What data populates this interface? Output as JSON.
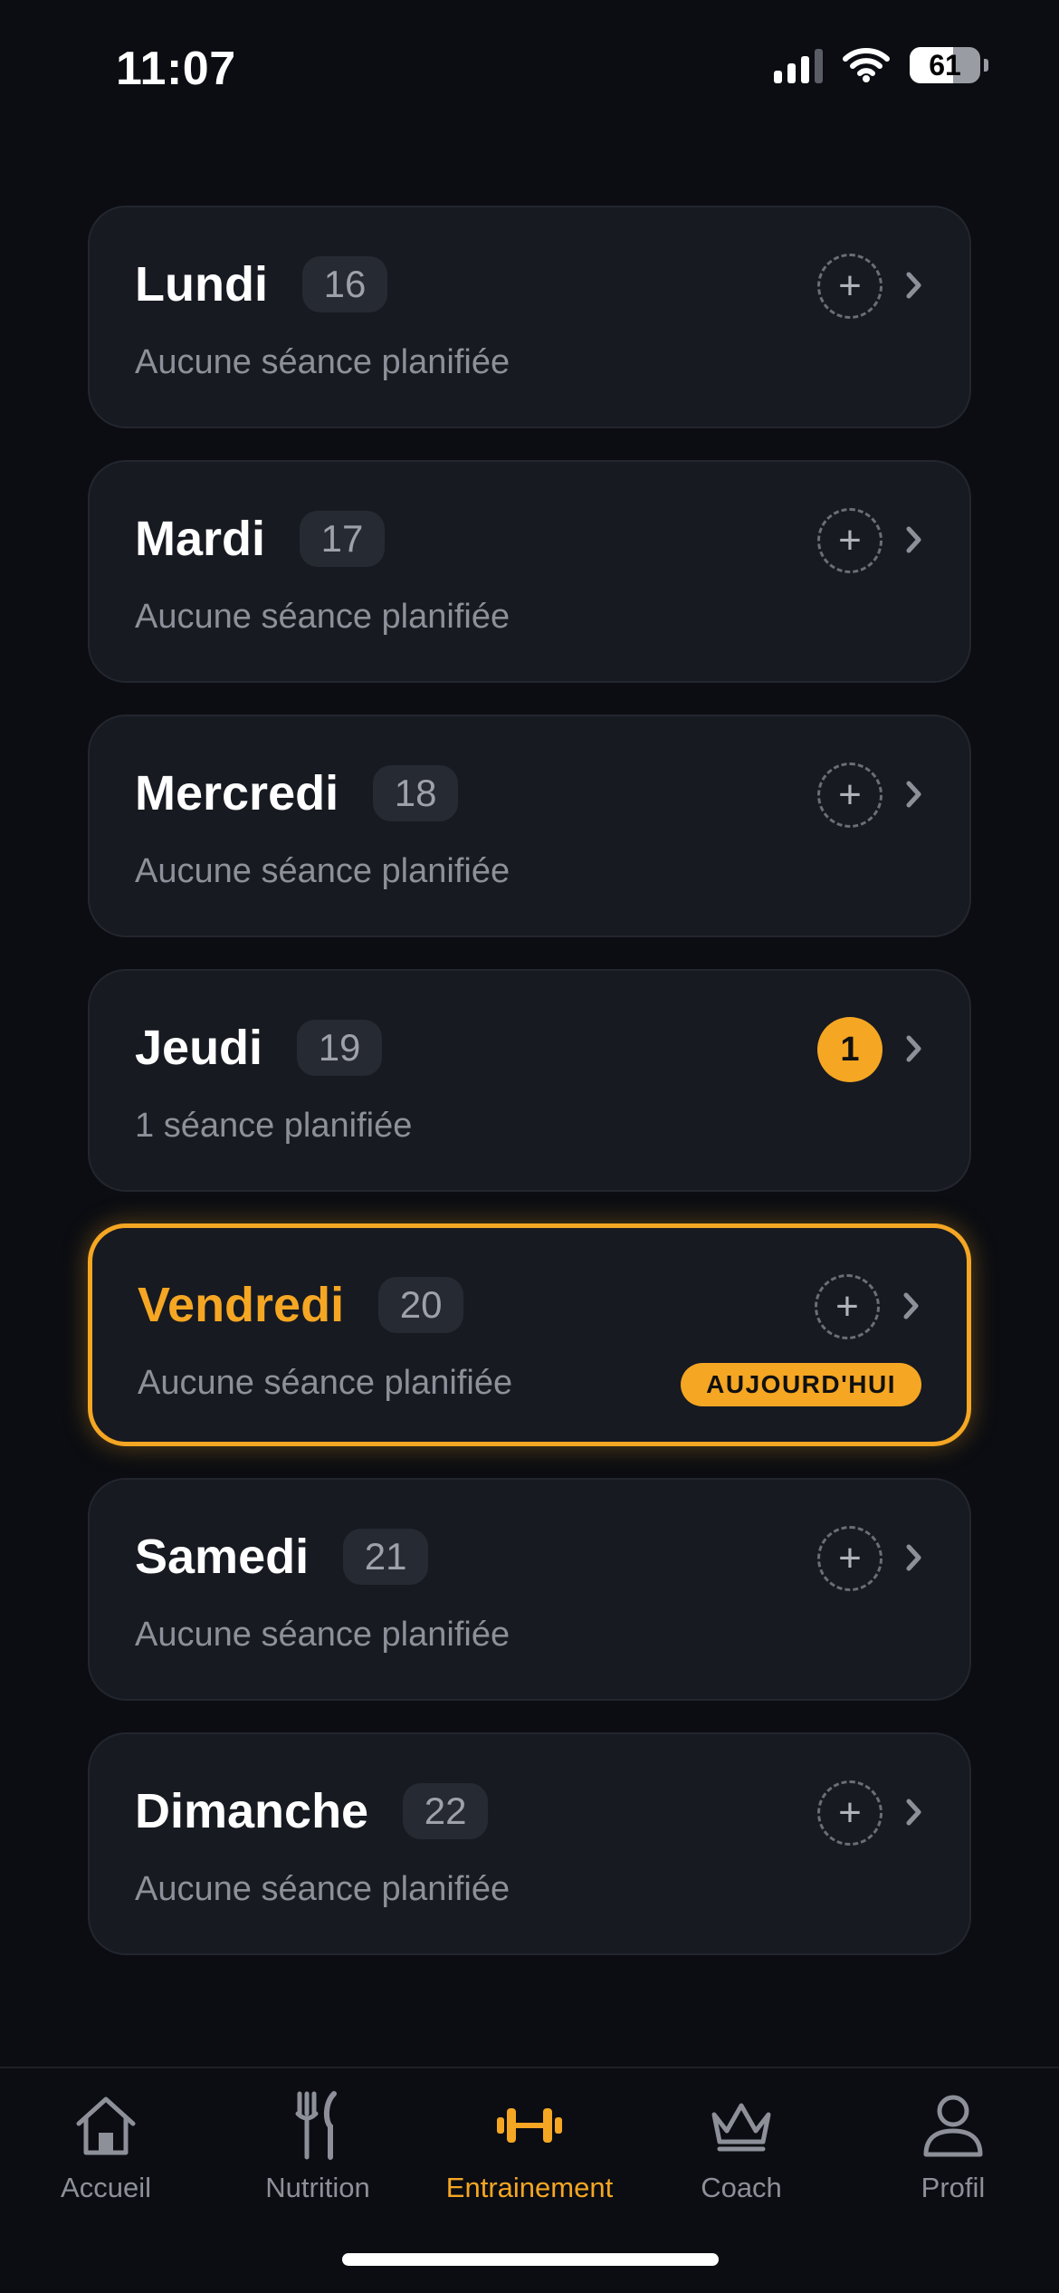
{
  "status_bar": {
    "time": "11:07",
    "battery": "61",
    "battery_level": 0.61
  },
  "days": [
    {
      "name": "Lundi",
      "date": "16",
      "subtitle": "Aucune séance planifiée"
    },
    {
      "name": "Mardi",
      "date": "17",
      "subtitle": "Aucune séance planifiée"
    },
    {
      "name": "Mercredi",
      "date": "18",
      "subtitle": "Aucune séance planifiée"
    },
    {
      "name": "Jeudi",
      "date": "19",
      "subtitle": "1 séance planifiée",
      "count": "1"
    },
    {
      "name": "Vendredi",
      "date": "20",
      "subtitle": "Aucune séance planifiée",
      "today_label": "AUJOURD'HUI"
    },
    {
      "name": "Samedi",
      "date": "21",
      "subtitle": "Aucune séance planifiée"
    },
    {
      "name": "Dimanche",
      "date": "22",
      "subtitle": "Aucune séance planifiée"
    }
  ],
  "tabs": [
    {
      "label": "Accueil",
      "icon": "home-icon"
    },
    {
      "label": "Nutrition",
      "icon": "fork-knife-icon"
    },
    {
      "label": "Entrainement",
      "icon": "dumbbell-icon",
      "active": true
    },
    {
      "label": "Coach",
      "icon": "crown-icon"
    },
    {
      "label": "Profil",
      "icon": "person-icon"
    }
  ],
  "colors": {
    "accent": "#f5a623",
    "background": "#0b0d12",
    "card": "#171a21",
    "muted_text": "#8d9099"
  },
  "add_symbol": "+"
}
